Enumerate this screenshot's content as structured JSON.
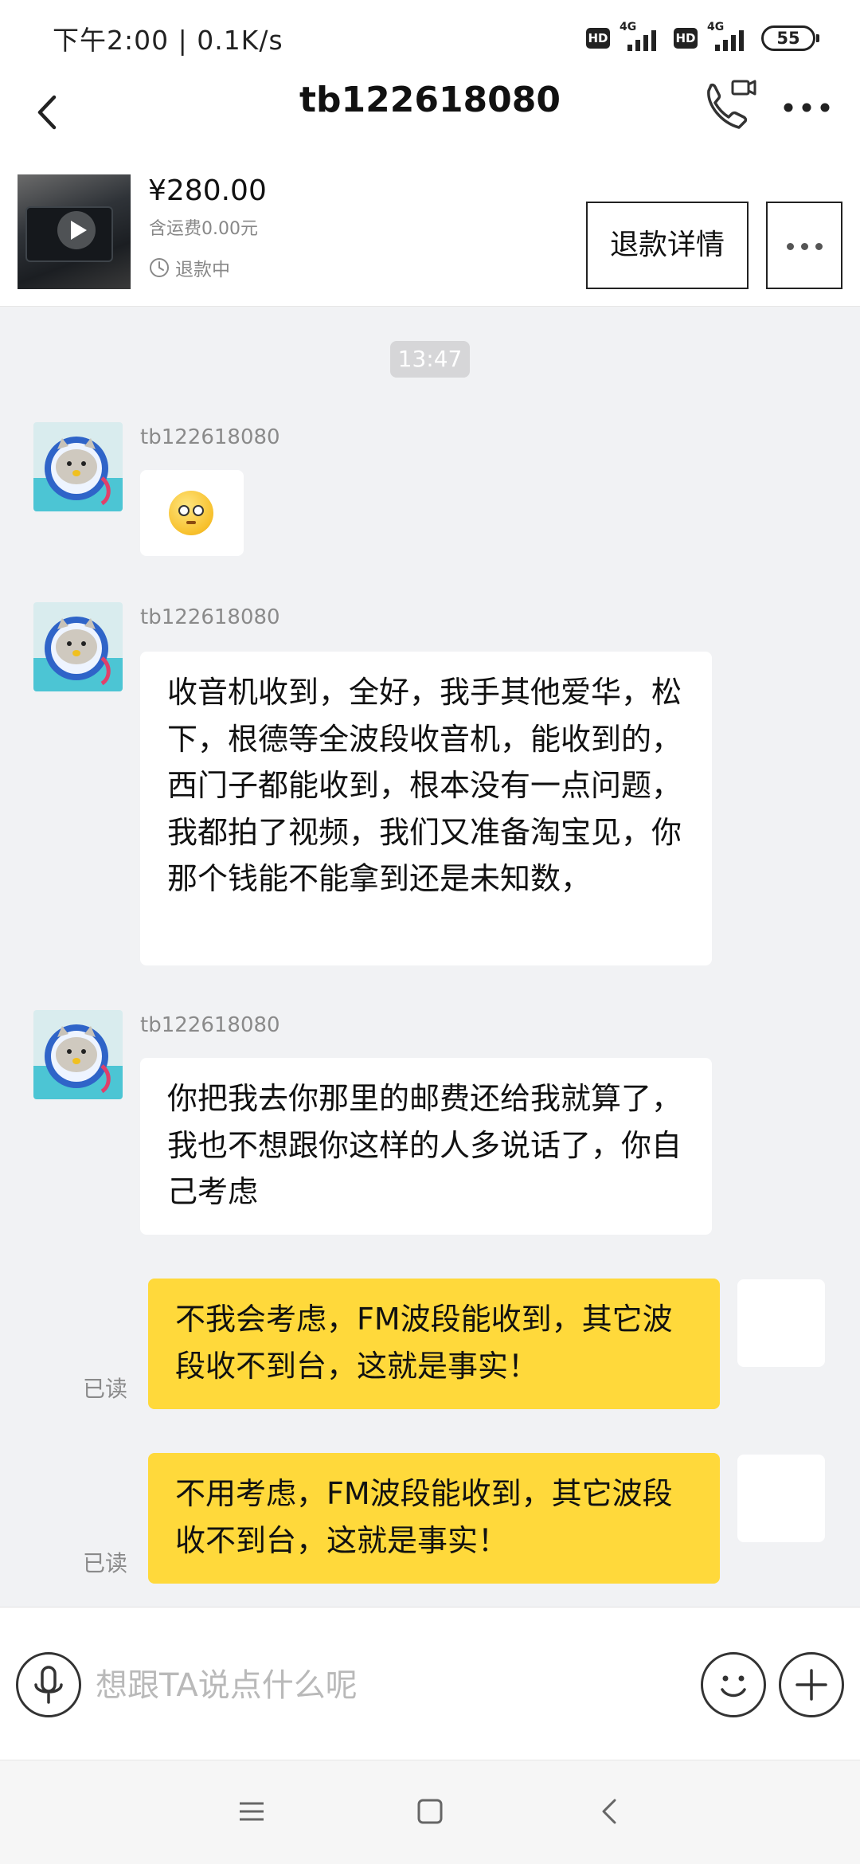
{
  "status_bar": {
    "time": "下午2:00 | 0.1K/s",
    "hd_badge": "HD",
    "network_1": "4G",
    "network_2": "4G",
    "battery": "55"
  },
  "nav": {
    "title": "tb122618080"
  },
  "order": {
    "price": "¥280.00",
    "shipping": "含运费0.00元",
    "status": "退款中",
    "refund_detail_label": "退款详情"
  },
  "chat": {
    "timestamp": "13:47",
    "messages": [
      {
        "sender": "tb122618080",
        "type": "emoji",
        "emoji": "flushed-face"
      },
      {
        "sender": "tb122618080",
        "type": "text",
        "text": "收音机收到，全好，我手其他爱华，松下，根德等全波段收音机，能收到的，西门子都能收到，根本没有一点问题，我都拍了视频，我们又准备淘宝见，你那个钱能不能拿到还是未知数，"
      },
      {
        "sender": "tb122618080",
        "type": "text",
        "text": "你把我去你那里的邮费还给我就算了，我也不想跟你这样的人多说话了，你自己考虑"
      },
      {
        "sender": "me",
        "type": "text",
        "text": "不我会考虑，FM波段能收到，其它波段收不到台，这就是事实！",
        "read": "已读"
      },
      {
        "sender": "me",
        "type": "text",
        "text": "不用考虑，FM波段能收到，其它波段收不到台，这就是事实！",
        "read": "已读"
      }
    ]
  },
  "input": {
    "placeholder": "想跟TA说点什么呢"
  },
  "colors": {
    "accent_yellow": "#ffd93b",
    "chat_background": "#f1f2f4"
  }
}
